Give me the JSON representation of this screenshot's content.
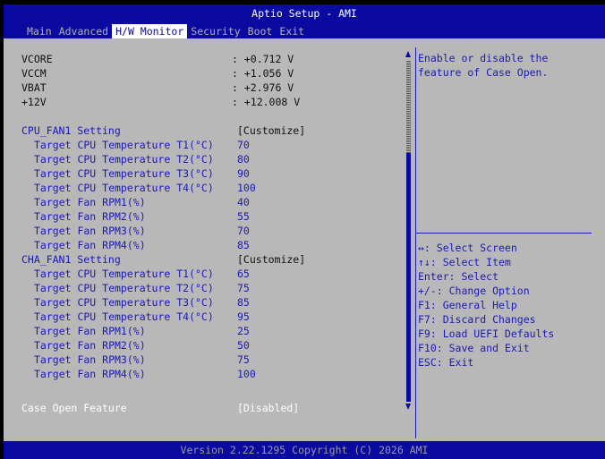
{
  "app": {
    "title": "Aptio Setup - AMI"
  },
  "tabs": [
    {
      "label": "Main"
    },
    {
      "label": "Advanced"
    },
    {
      "label": "H/W Monitor"
    },
    {
      "label": "Security"
    },
    {
      "label": "Boot"
    },
    {
      "label": "Exit"
    }
  ],
  "voltages": [
    {
      "label": "VCORE",
      "value": ": +0.712 V"
    },
    {
      "label": "VCCM",
      "value": ": +1.056 V"
    },
    {
      "label": "VBAT",
      "value": ": +2.976 V"
    },
    {
      "label": "+12V",
      "value": ": +12.008 V"
    }
  ],
  "cpu_fan": {
    "label": "CPU_FAN1 Setting",
    "value": "[Customize]",
    "items": [
      {
        "label": "Target CPU Temperature T1(°C)",
        "value": "70"
      },
      {
        "label": "Target CPU Temperature T2(°C)",
        "value": "80"
      },
      {
        "label": "Target CPU Temperature T3(°C)",
        "value": "90"
      },
      {
        "label": "Target CPU Temperature T4(°C)",
        "value": "100"
      },
      {
        "label": "Target Fan RPM1(%)",
        "value": "40"
      },
      {
        "label": "Target Fan RPM2(%)",
        "value": "55"
      },
      {
        "label": "Target Fan RPM3(%)",
        "value": "70"
      },
      {
        "label": "Target Fan RPM4(%)",
        "value": "85"
      }
    ]
  },
  "cha_fan": {
    "label": "CHA_FAN1 Setting",
    "value": "[Customize]",
    "items": [
      {
        "label": "Target CPU Temperature T1(°C)",
        "value": "65"
      },
      {
        "label": "Target CPU Temperature T2(°C)",
        "value": "75"
      },
      {
        "label": "Target CPU Temperature T3(°C)",
        "value": "85"
      },
      {
        "label": "Target CPU Temperature T4(°C)",
        "value": "95"
      },
      {
        "label": "Target Fan RPM1(%)",
        "value": "25"
      },
      {
        "label": "Target Fan RPM2(%)",
        "value": "50"
      },
      {
        "label": "Target Fan RPM3(%)",
        "value": "75"
      },
      {
        "label": "Target Fan RPM4(%)",
        "value": "100"
      }
    ]
  },
  "case_open": {
    "label": "Case Open Feature",
    "value": "[Disabled]"
  },
  "help": {
    "text": "Enable or disable the feature of Case Open."
  },
  "keys": [
    "↔: Select Screen",
    "↑↓: Select Item",
    "Enter: Select",
    "+/-: Change Option",
    "F1: General Help",
    "F7: Discard Changes",
    "F9: Load UEFI Defaults",
    "F10: Save and Exit",
    "ESC: Exit"
  ],
  "footer": {
    "text": "Version 2.22.1295 Copyright (C) 2026 AMI"
  },
  "colors": {
    "header_bg": "#0a0aa0",
    "body_bg": "#b8b8b8",
    "text_blue": "#1a1ab4",
    "highlight": "#ffffff"
  }
}
